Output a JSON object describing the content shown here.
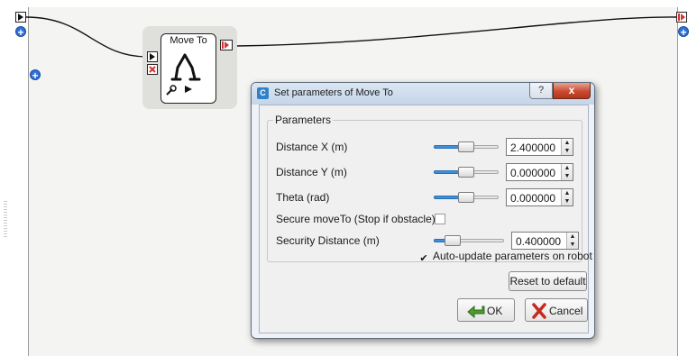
{
  "box": {
    "title": "Move To"
  },
  "dialog": {
    "title": "Set parameters of Move To",
    "help_label": "?",
    "close_label": "x",
    "group_title": "Parameters",
    "params": [
      {
        "label": "Distance X (m)",
        "value": "2.400000",
        "slider_level": 0.5
      },
      {
        "label": "Distance Y (m)",
        "value": "0.000000",
        "slider_level": 0.5
      },
      {
        "label": "Theta (rad)",
        "value": "0.000000",
        "slider_level": 0.5
      }
    ],
    "secure": {
      "label": "Secure moveTo (Stop if obstacle)",
      "checked": false
    },
    "security_distance": {
      "label": "Security Distance (m)",
      "value": "0.400000",
      "slider_level": 0.2
    },
    "auto_update": {
      "label": "Auto-update parameters on robot",
      "checked": true
    },
    "reset_label": "Reset to default",
    "ok_label": "OK",
    "cancel_label": "Cancel"
  },
  "colors": {
    "slider_fill": "#3f8fdb",
    "plus_button": "#2f6fd6",
    "close_button": "#c84c31",
    "output_port_arrow": "#d63333",
    "stop_port": "#d63333"
  },
  "icons": [
    "play-icon",
    "plus-icon",
    "stop-icon",
    "output-icon",
    "robot-legs-icon",
    "wrench-icon",
    "ok-arrow-icon",
    "cancel-x-icon",
    "spin-up-icon",
    "spin-down-icon"
  ]
}
